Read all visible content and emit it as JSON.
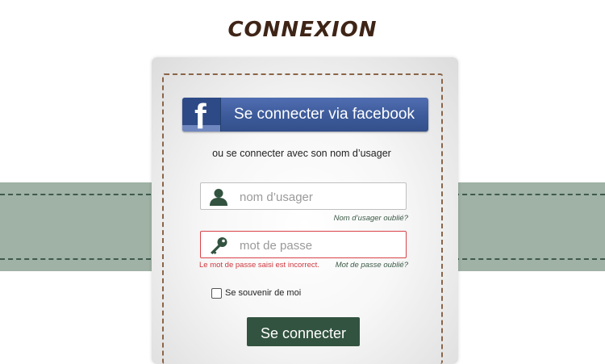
{
  "page": {
    "title": "CONNEXION"
  },
  "login": {
    "facebook_label": "Se connecter via facebook",
    "alt_text": "ou se connecter avec son nom d’usager",
    "username_placeholder": "nom d’usager",
    "username_forgot": "Nom d’usager oublié?",
    "password_placeholder": "mot de passe",
    "password_error": "Le mot de passe saisi est incorrect.",
    "password_forgot": "Mot de passe oublié?",
    "remember_label": "Se souvenir de moi",
    "submit_label": "Se connecter"
  },
  "colors": {
    "title": "#3f2517",
    "band": "#9fb2a5",
    "facebook": "#3b5998",
    "error": "#d0383f",
    "submit": "#32533f"
  },
  "icons": {
    "user": "user-icon",
    "key": "key-icon",
    "facebook": "facebook-icon"
  }
}
